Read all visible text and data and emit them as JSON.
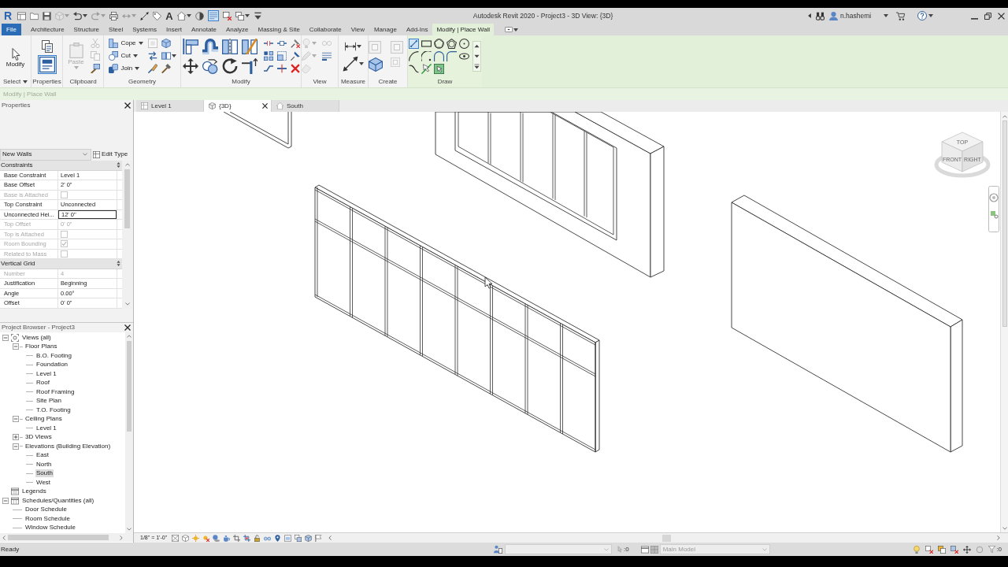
{
  "window": {
    "title": "Autodesk Revit 2020 - Project3 - 3D View: {3D}"
  },
  "quick_access": [
    {
      "label": "R",
      "disabled": false
    },
    {
      "disabled": false
    },
    {
      "disabled": false
    },
    {
      "disabled": false
    },
    {
      "disabled": true
    },
    {
      "disabled": false
    },
    {
      "disabled": true
    },
    {
      "disabled": false
    },
    {
      "disabled": true
    },
    {
      "disabled": false
    },
    {
      "disabled": false
    },
    {
      "label": "A",
      "disabled": false
    },
    {
      "disabled": false
    },
    {
      "disabled": false
    },
    {
      "disabled": false,
      "on": true
    },
    {
      "disabled": false
    },
    {
      "disabled": false
    },
    {
      "disabled": false
    }
  ],
  "user": {
    "name": "n.hashemi"
  },
  "ribbon_tabs": [
    {
      "label": "File",
      "kind": "file",
      "selected": false
    },
    {
      "label": "Architecture",
      "kind": "standard",
      "selected": false
    },
    {
      "label": "Structure",
      "kind": "standard",
      "selected": false
    },
    {
      "label": "Steel",
      "kind": "standard",
      "selected": false
    },
    {
      "label": "Systems",
      "kind": "standard",
      "selected": false
    },
    {
      "label": "Insert",
      "kind": "standard",
      "selected": false
    },
    {
      "label": "Annotate",
      "kind": "standard",
      "selected": false
    },
    {
      "label": "Analyze",
      "kind": "standard",
      "selected": false
    },
    {
      "label": "Massing & Site",
      "kind": "standard",
      "selected": false
    },
    {
      "label": "Collaborate",
      "kind": "standard",
      "selected": false
    },
    {
      "label": "View",
      "kind": "standard",
      "selected": false
    },
    {
      "label": "Manage",
      "kind": "standard",
      "selected": false
    },
    {
      "label": "Add-Ins",
      "kind": "standard",
      "selected": false
    },
    {
      "label": "Modify | Place Wall",
      "kind": "contextual",
      "selected": true
    }
  ],
  "ribbon_panels": [
    {
      "label": "Select",
      "dropdown": true,
      "tools": [
        {
          "label": "Modify",
          "disabled": false
        }
      ]
    },
    {
      "label": "Properties",
      "dropdown": false,
      "tools": [
        {
          "disabled": false
        },
        {
          "disabled": false,
          "on": true
        }
      ]
    },
    {
      "label": "Clipboard",
      "dropdown": false,
      "tools": [
        {
          "label": "Paste",
          "disabled": true
        },
        {
          "disabled": true
        },
        {
          "disabled": true
        },
        {
          "disabled": false
        }
      ]
    },
    {
      "label": "Geometry",
      "dropdown": false,
      "tools": [
        {
          "label": "Cope",
          "disabled": false
        },
        {
          "label": "Cut",
          "disabled": false
        },
        {
          "label": "Join",
          "disabled": false
        },
        {
          "disabled": true
        },
        {
          "disabled": false
        },
        {
          "disabled": false
        },
        {
          "disabled": false
        },
        {
          "disabled": false
        },
        {
          "disabled": false
        }
      ]
    },
    {
      "label": "Modify",
      "dropdown": false,
      "tools": [
        {
          "disabled": false
        },
        {
          "disabled": false
        },
        {
          "disabled": false
        },
        {
          "disabled": false
        },
        {
          "disabled": false
        },
        {
          "disabled": false
        },
        {
          "disabled": false
        },
        {
          "disabled": false
        },
        {
          "disabled": false
        },
        {
          "disabled": false
        },
        {
          "disabled": false
        },
        {
          "disabled": false
        },
        {
          "disabled": false
        },
        {
          "disabled": false
        },
        {
          "disabled": false
        },
        {
          "disabled": false
        },
        {
          "disabled": false
        }
      ]
    },
    {
      "label": "View",
      "dropdown": false,
      "tools": [
        {
          "disabled": true
        },
        {
          "disabled": true
        },
        {
          "disabled": true
        },
        {
          "disabled": false
        },
        {
          "disabled": true
        }
      ]
    },
    {
      "label": "Measure",
      "dropdown": false,
      "tools": [
        {
          "disabled": false
        },
        {
          "disabled": false
        }
      ]
    },
    {
      "label": "Create",
      "dropdown": false,
      "tools": [
        {
          "disabled": true
        },
        {
          "disabled": true
        },
        {
          "disabled": false
        },
        {
          "disabled": true
        }
      ]
    },
    {
      "label": "Draw",
      "dropdown": false,
      "tools": [
        {
          "selected": true
        },
        {
          "selected": false
        },
        {
          "selected": false
        },
        {
          "selected": false
        },
        {
          "selected": false
        },
        {
          "selected": false
        },
        {
          "selected": false
        },
        {
          "selected": false
        },
        {
          "selected": false
        },
        {
          "selected": false
        },
        {
          "selected": false
        },
        {
          "selected": false
        },
        {
          "selected": false
        }
      ]
    }
  ],
  "options_bar": {
    "label": "Modify | Place Wall"
  },
  "properties": {
    "title": "Properties",
    "type_selector": "New Walls",
    "edit_type": "Edit Type",
    "groups": [
      {
        "label": "Constraints",
        "rows": [
          {
            "label": "Base Constraint",
            "kind": "text",
            "value": "Level 1",
            "disabled": false,
            "editing": false
          },
          {
            "label": "Base Offset",
            "kind": "text",
            "value": "2' 0\"",
            "disabled": false,
            "editing": false
          },
          {
            "label": "Base is Attached",
            "kind": "checkbox",
            "checked": false,
            "disabled": true
          },
          {
            "label": "Top Constraint",
            "kind": "text",
            "value": "Unconnected",
            "disabled": false,
            "editing": false
          },
          {
            "label": "Unconnected Hei...",
            "kind": "text",
            "value": "12' 0\"",
            "disabled": false,
            "editing": true
          },
          {
            "label": "Top Offset",
            "kind": "text",
            "value": "0' 0\"",
            "disabled": true,
            "editing": false
          },
          {
            "label": "Top is Attached",
            "kind": "checkbox",
            "checked": false,
            "disabled": true
          },
          {
            "label": "Room Bounding",
            "kind": "checkbox",
            "checked": true,
            "disabled": true
          },
          {
            "label": "Related to Mass",
            "kind": "checkbox",
            "checked": false,
            "disabled": true
          }
        ]
      },
      {
        "label": "Vertical Grid",
        "rows": [
          {
            "label": "Number",
            "kind": "text",
            "value": "4",
            "disabled": true,
            "editing": false
          },
          {
            "label": "Justification",
            "kind": "text",
            "value": "Beginning",
            "disabled": false,
            "editing": false
          },
          {
            "label": "Angle",
            "kind": "text",
            "value": "0.00°",
            "disabled": false,
            "editing": false
          },
          {
            "label": "Offset",
            "kind": "text",
            "value": "0' 0\"",
            "disabled": false,
            "editing": false
          }
        ]
      }
    ]
  },
  "view_tabs": [
    {
      "label": "Level 1",
      "selected": false
    },
    {
      "label": "{3D}",
      "selected": true
    },
    {
      "label": "South",
      "selected": false
    }
  ],
  "project_browser": {
    "title": "Project Browser - Project3",
    "tree": [
      {
        "label": "Views (all)",
        "expanded": true,
        "selected": false,
        "children": [
          {
            "label": "Floor Plans",
            "expanded": true,
            "selected": false,
            "children": [
              {
                "label": "B.O. Footing",
                "selected": false
              },
              {
                "label": "Foundation",
                "selected": false
              },
              {
                "label": "Level 1",
                "selected": false
              },
              {
                "label": "Roof",
                "selected": false
              },
              {
                "label": "Roof Framing",
                "selected": false
              },
              {
                "label": "Site Plan",
                "selected": false
              },
              {
                "label": "T.O. Footing",
                "selected": false
              }
            ]
          },
          {
            "label": "Ceiling Plans",
            "expanded": true,
            "selected": false,
            "children": [
              {
                "label": "Level 1",
                "selected": false
              }
            ]
          },
          {
            "label": "3D Views",
            "expanded": false,
            "selected": false
          },
          {
            "label": "Elevations (Building Elevation)",
            "expanded": true,
            "selected": false,
            "children": [
              {
                "label": "East",
                "selected": false
              },
              {
                "label": "North",
                "selected": false
              },
              {
                "label": "South",
                "selected": true
              },
              {
                "label": "West",
                "selected": false
              }
            ]
          }
        ]
      },
      {
        "label": "Legends",
        "selected": false
      },
      {
        "label": "Schedules/Quantities (all)",
        "expanded": true,
        "selected": false,
        "children": [
          {
            "label": "Door Schedule",
            "selected": false
          },
          {
            "label": "Room Schedule",
            "selected": false
          },
          {
            "label": "Window Schedule",
            "selected": false
          }
        ]
      }
    ]
  },
  "view_cube": {
    "faces": [
      "TOP",
      "FRONT",
      "RIGHT"
    ]
  },
  "view_control_bar": {
    "scale": "1/8\" = 1'-0\""
  },
  "status_bar": {
    "message": "Ready",
    "counter": ":0",
    "design_option": "Main Model",
    "filter_count": ":0"
  }
}
